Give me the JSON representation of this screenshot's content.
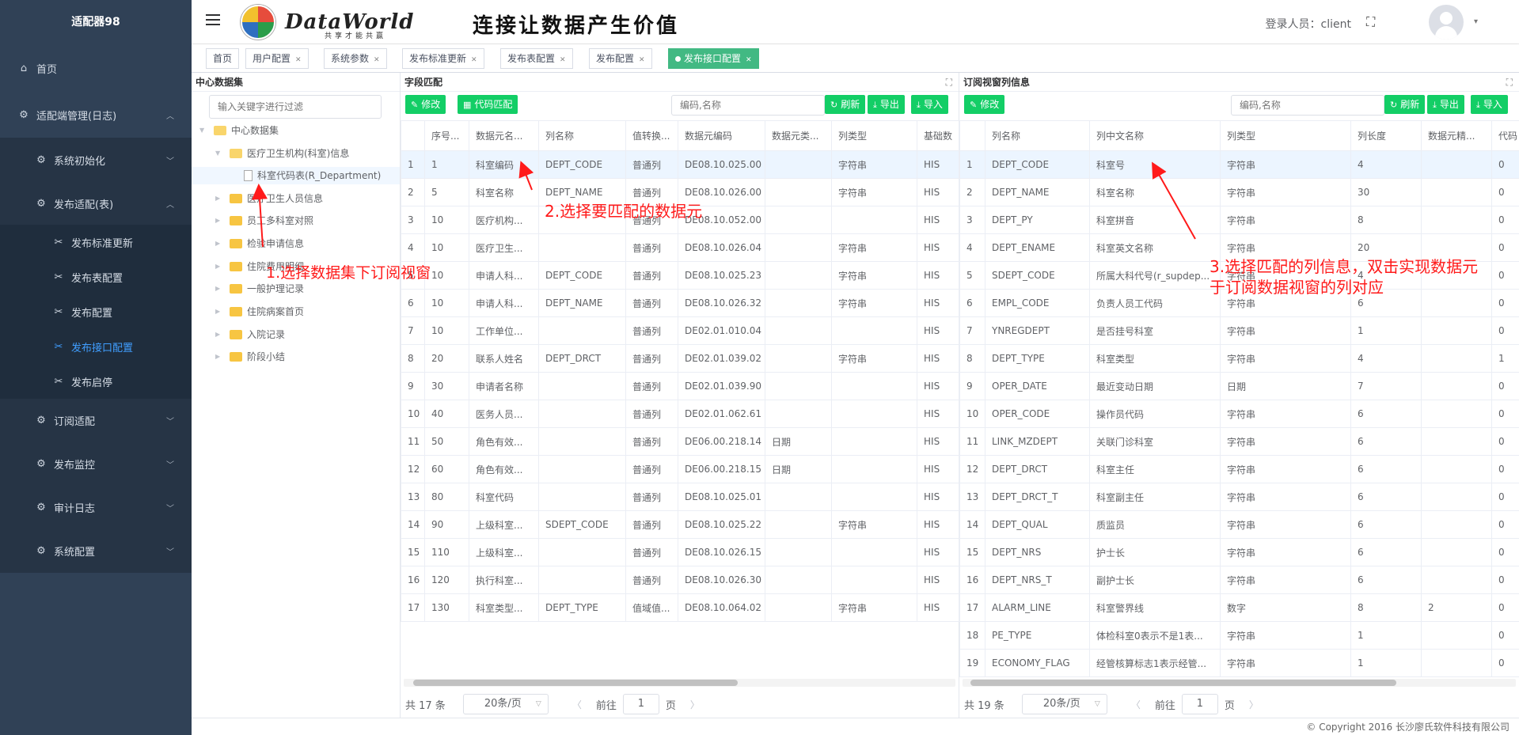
{
  "app": {
    "name": "适配器98",
    "logo_title": "DataWorld",
    "logo_sub": "共享才能共赢",
    "slogan": "连接让数据产生价值"
  },
  "header": {
    "login_label": "登录人员：client"
  },
  "sidebar": {
    "home": "首页",
    "adapter_mgmt": "适配端管理(日志)",
    "sys_init": "系统初始化",
    "publish_adapt": "发布适配(表)",
    "leaves": [
      "发布标准更新",
      "发布表配置",
      "发布配置",
      "发布接口配置",
      "发布启停"
    ],
    "subscribe_adapt": "订阅适配",
    "publish_monitor": "发布监控",
    "audit_log": "审计日志",
    "sys_config": "系统配置"
  },
  "tags": [
    "首页",
    "用户配置",
    "系统参数",
    "发布标准更新",
    "发布表配置",
    "发布配置",
    "发布接口配置"
  ],
  "tree": {
    "title": "中心数据集",
    "filter_placeholder": "输入关键字进行过滤",
    "root": "中心数据集",
    "nodes": [
      "医疗卫生机构(科室)信息",
      "科室代码表(R_Department)",
      "医疗卫生人员信息",
      "员工多科室对照",
      "检验申请信息",
      "住院费用明细",
      "一般护理记录",
      "住院病案首页",
      "入院记录",
      "阶段小结"
    ]
  },
  "field_panel": {
    "title": "字段匹配",
    "edit_btn": "修改",
    "code_match_btn": "代码匹配",
    "search_placeholder": "编码,名称",
    "refresh_btn": "刷新",
    "export_btn": "导出",
    "import_btn": "导入",
    "columns": [
      "",
      "序号...",
      "数据元名...",
      "列名称",
      "值转换...",
      "数据元编码",
      "数据元类...",
      "列类型",
      "基础数"
    ],
    "rows": [
      [
        "1",
        "1",
        "科室编码",
        "DEPT_CODE",
        "普通列",
        "DE08.10.025.00",
        "",
        "字符串",
        "HIS"
      ],
      [
        "2",
        "5",
        "科室名称",
        "DEPT_NAME",
        "普通列",
        "DE08.10.026.00",
        "",
        "字符串",
        "HIS"
      ],
      [
        "3",
        "10",
        "医疗机构...",
        "",
        "普通列",
        "DE08.10.052.00",
        "",
        "",
        "HIS"
      ],
      [
        "4",
        "10",
        "医疗卫生...",
        "",
        "普通列",
        "DE08.10.026.04",
        "",
        "字符串",
        "HIS"
      ],
      [
        "5",
        "10",
        "申请人科...",
        "DEPT_CODE",
        "普通列",
        "DE08.10.025.23",
        "",
        "字符串",
        "HIS"
      ],
      [
        "6",
        "10",
        "申请人科...",
        "DEPT_NAME",
        "普通列",
        "DE08.10.026.32",
        "",
        "字符串",
        "HIS"
      ],
      [
        "7",
        "10",
        "工作单位...",
        "",
        "普通列",
        "DE02.01.010.04",
        "",
        "",
        "HIS"
      ],
      [
        "8",
        "20",
        "联系人姓名",
        "DEPT_DRCT",
        "普通列",
        "DE02.01.039.02",
        "",
        "字符串",
        "HIS"
      ],
      [
        "9",
        "30",
        "申请者名称",
        "",
        "普通列",
        "DE02.01.039.90",
        "",
        "",
        "HIS"
      ],
      [
        "10",
        "40",
        "医务人员...",
        "",
        "普通列",
        "DE02.01.062.61",
        "",
        "",
        "HIS"
      ],
      [
        "11",
        "50",
        "角色有效...",
        "",
        "普通列",
        "DE06.00.218.14",
        "日期",
        "",
        "HIS"
      ],
      [
        "12",
        "60",
        "角色有效...",
        "",
        "普通列",
        "DE06.00.218.15",
        "日期",
        "",
        "HIS"
      ],
      [
        "13",
        "80",
        "科室代码",
        "",
        "普通列",
        "DE08.10.025.01",
        "",
        "",
        "HIS"
      ],
      [
        "14",
        "90",
        "上级科室...",
        "SDEPT_CODE",
        "普通列",
        "DE08.10.025.22",
        "",
        "字符串",
        "HIS"
      ],
      [
        "15",
        "110",
        "上级科室...",
        "",
        "普通列",
        "DE08.10.026.15",
        "",
        "",
        "HIS"
      ],
      [
        "16",
        "120",
        "执行科室...",
        "",
        "普通列",
        "DE08.10.026.30",
        "",
        "",
        "HIS"
      ],
      [
        "17",
        "130",
        "科室类型...",
        "DEPT_TYPE",
        "值域值...",
        "DE08.10.064.02",
        "",
        "字符串",
        "HIS"
      ]
    ],
    "total": "共 17 条",
    "page_size": "20条/页",
    "goto_label": "前往",
    "page": "1",
    "page_unit": "页"
  },
  "view_panel": {
    "title": "订阅视窗列信息",
    "edit_btn": "修改",
    "search_placeholder": "编码,名称",
    "refresh_btn": "刷新",
    "export_btn": "导出",
    "import_btn": "导入",
    "columns": [
      "",
      "列名称",
      "列中文名称",
      "列类型",
      "列长度",
      "数据元精...",
      "代码"
    ],
    "rows": [
      [
        "1",
        "DEPT_CODE",
        "科室号",
        "字符串",
        "4",
        "",
        "0"
      ],
      [
        "2",
        "DEPT_NAME",
        "科室名称",
        "字符串",
        "30",
        "",
        "0"
      ],
      [
        "3",
        "DEPT_PY",
        "科室拼音",
        "字符串",
        "8",
        "",
        "0"
      ],
      [
        "4",
        "DEPT_ENAME",
        "科室英文名称",
        "字符串",
        "20",
        "",
        "0"
      ],
      [
        "5",
        "SDEPT_CODE",
        "所属大科代号(r_supdep...",
        "字符串",
        "4",
        "",
        "0"
      ],
      [
        "6",
        "EMPL_CODE",
        "负责人员工代码",
        "字符串",
        "6",
        "",
        "0"
      ],
      [
        "7",
        "YNREGDEPT",
        "是否挂号科室",
        "字符串",
        "1",
        "",
        "0"
      ],
      [
        "8",
        "DEPT_TYPE",
        "科室类型",
        "字符串",
        "4",
        "",
        "1"
      ],
      [
        "9",
        "OPER_DATE",
        "最近变动日期",
        "日期",
        "7",
        "",
        "0"
      ],
      [
        "10",
        "OPER_CODE",
        "操作员代码",
        "字符串",
        "6",
        "",
        "0"
      ],
      [
        "11",
        "LINK_MZDEPT",
        "关联门诊科室",
        "字符串",
        "6",
        "",
        "0"
      ],
      [
        "12",
        "DEPT_DRCT",
        "科室主任",
        "字符串",
        "6",
        "",
        "0"
      ],
      [
        "13",
        "DEPT_DRCT_T",
        "科室副主任",
        "字符串",
        "6",
        "",
        "0"
      ],
      [
        "14",
        "DEPT_QUAL",
        "质监员",
        "字符串",
        "6",
        "",
        "0"
      ],
      [
        "15",
        "DEPT_NRS",
        "护士长",
        "字符串",
        "6",
        "",
        "0"
      ],
      [
        "16",
        "DEPT_NRS_T",
        "副护士长",
        "字符串",
        "6",
        "",
        "0"
      ],
      [
        "17",
        "ALARM_LINE",
        "科室警界线",
        "数字",
        "8",
        "2",
        "0"
      ],
      [
        "18",
        "PE_TYPE",
        "体检科室0表示不是1表...",
        "字符串",
        "1",
        "",
        "0"
      ],
      [
        "19",
        "ECONOMY_FLAG",
        "经管核算标志1表示经管...",
        "字符串",
        "1",
        "",
        "0"
      ]
    ],
    "total": "共 19 条",
    "page_size": "20条/页",
    "goto_label": "前往",
    "page": "1",
    "page_unit": "页"
  },
  "annotations": {
    "step1": "1.选择数据集下订阅视窗",
    "step2": "2.选择要匹配的数据元",
    "step3_line1": "3.选择匹配的列信息，双击实现数据元",
    "step3_line2": "于订阅数据视窗的列对应"
  },
  "footer": {
    "copyright": "© Copyright 2016 长沙廖氏软件科技有限公司"
  },
  "colors": {
    "sidebar_bg": "#304156",
    "accent_green": "#13ce66",
    "active_tag": "#42b983",
    "annotation": "#ff1a1a",
    "menu_active": "#409eff"
  }
}
